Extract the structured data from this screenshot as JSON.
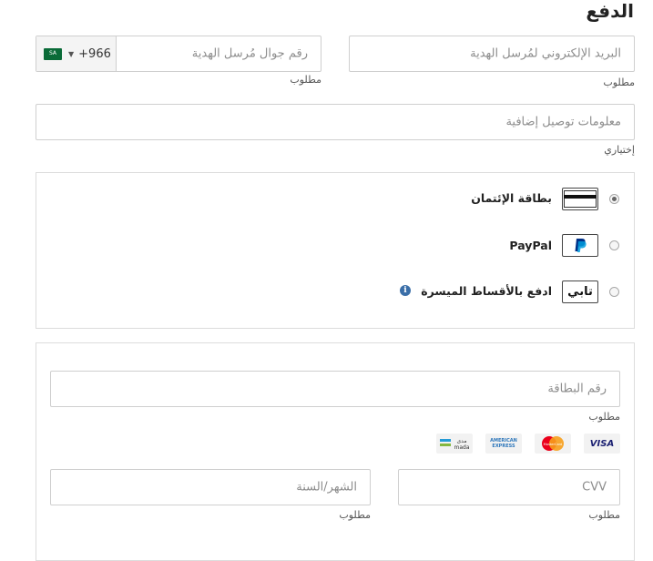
{
  "header": {
    "title": "الدفع"
  },
  "contact": {
    "email": {
      "placeholder": "البريد الإلكتروني لمُرسل الهدية",
      "hint": "مطلوب"
    },
    "phone": {
      "placeholder": "رقم جوال مُرسل الهدية",
      "hint": "مطلوب",
      "country_code": "+966",
      "flag_text": "SA"
    },
    "delivery": {
      "placeholder": "معلومات توصيل إضافية",
      "hint": "إختياري"
    }
  },
  "payment_methods": {
    "credit_card": {
      "label": "بطاقة الإئتمان",
      "selected": true
    },
    "paypal": {
      "label": "PayPal",
      "selected": false
    },
    "tabby": {
      "label": "ادفع بالأقساط الميسرة",
      "logo_text": "تابي",
      "selected": false,
      "info_glyph": "i"
    }
  },
  "card_form": {
    "card_number": {
      "placeholder": "رقم البطاقة",
      "hint": "مطلوب"
    },
    "brands": {
      "visa": "VISA",
      "mastercard": "MasterCard",
      "amex_line1": "AMERICAN",
      "amex_line2": "EXPRESS",
      "mada_ar": "مدى",
      "mada_en": "mada"
    },
    "cvv": {
      "placeholder": "CVV",
      "hint": "مطلوب"
    },
    "expiry": {
      "placeholder": "الشهر/السنة",
      "hint": "مطلوب"
    }
  },
  "colors": {
    "border": "#cfcfcf",
    "paypal_blue": "#003087",
    "flag_green": "#0a6b38",
    "info_blue": "#3a6ea8"
  }
}
